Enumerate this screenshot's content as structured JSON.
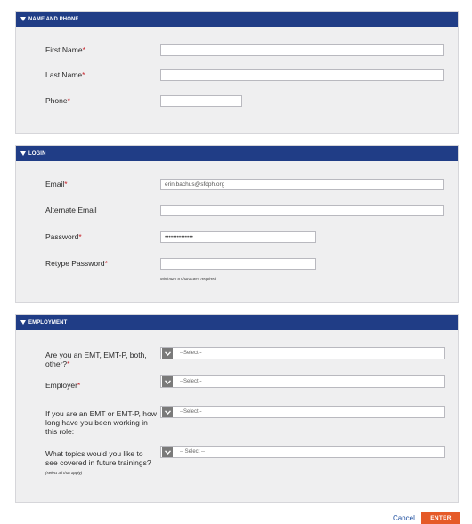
{
  "sections": {
    "name_phone": {
      "title": "NAME AND PHONE",
      "first_name_label": "First Name",
      "last_name_label": "Last Name",
      "phone_label": "Phone",
      "first_name_value": "",
      "last_name_value": "",
      "phone_value": ""
    },
    "login": {
      "title": "LOGIN",
      "email_label": "Email",
      "email_value": "erin.bachus@sfdph.org",
      "alt_email_label": "Alternate Email",
      "alt_email_value": "",
      "password_label": "Password",
      "password_value": "••••••••••••••",
      "retype_label": "Retype Password",
      "retype_value": "",
      "password_hint": "Minimum 8 characters required"
    },
    "employment": {
      "title": "EMPLOYMENT",
      "q1_label": "Are you an EMT, EMT-P, both, other?",
      "q1_value": "--Select--",
      "employer_label": "Employer",
      "employer_value": "--Select--",
      "q3_label": "If you are an EMT or EMT-P, how long have you been working in this role:",
      "q3_value": "--Select--",
      "q4_label": "What topics would you like to see covered in future trainings?",
      "q4_note": "(select all that apply)",
      "q4_value": "-- Select --"
    }
  },
  "required_marker": "*",
  "footer": {
    "cancel_label": "Cancel",
    "enter_label": "ENTER"
  },
  "colors": {
    "header_bg": "#203d86",
    "required": "#c6242c",
    "enter_button": "#e55a28"
  }
}
